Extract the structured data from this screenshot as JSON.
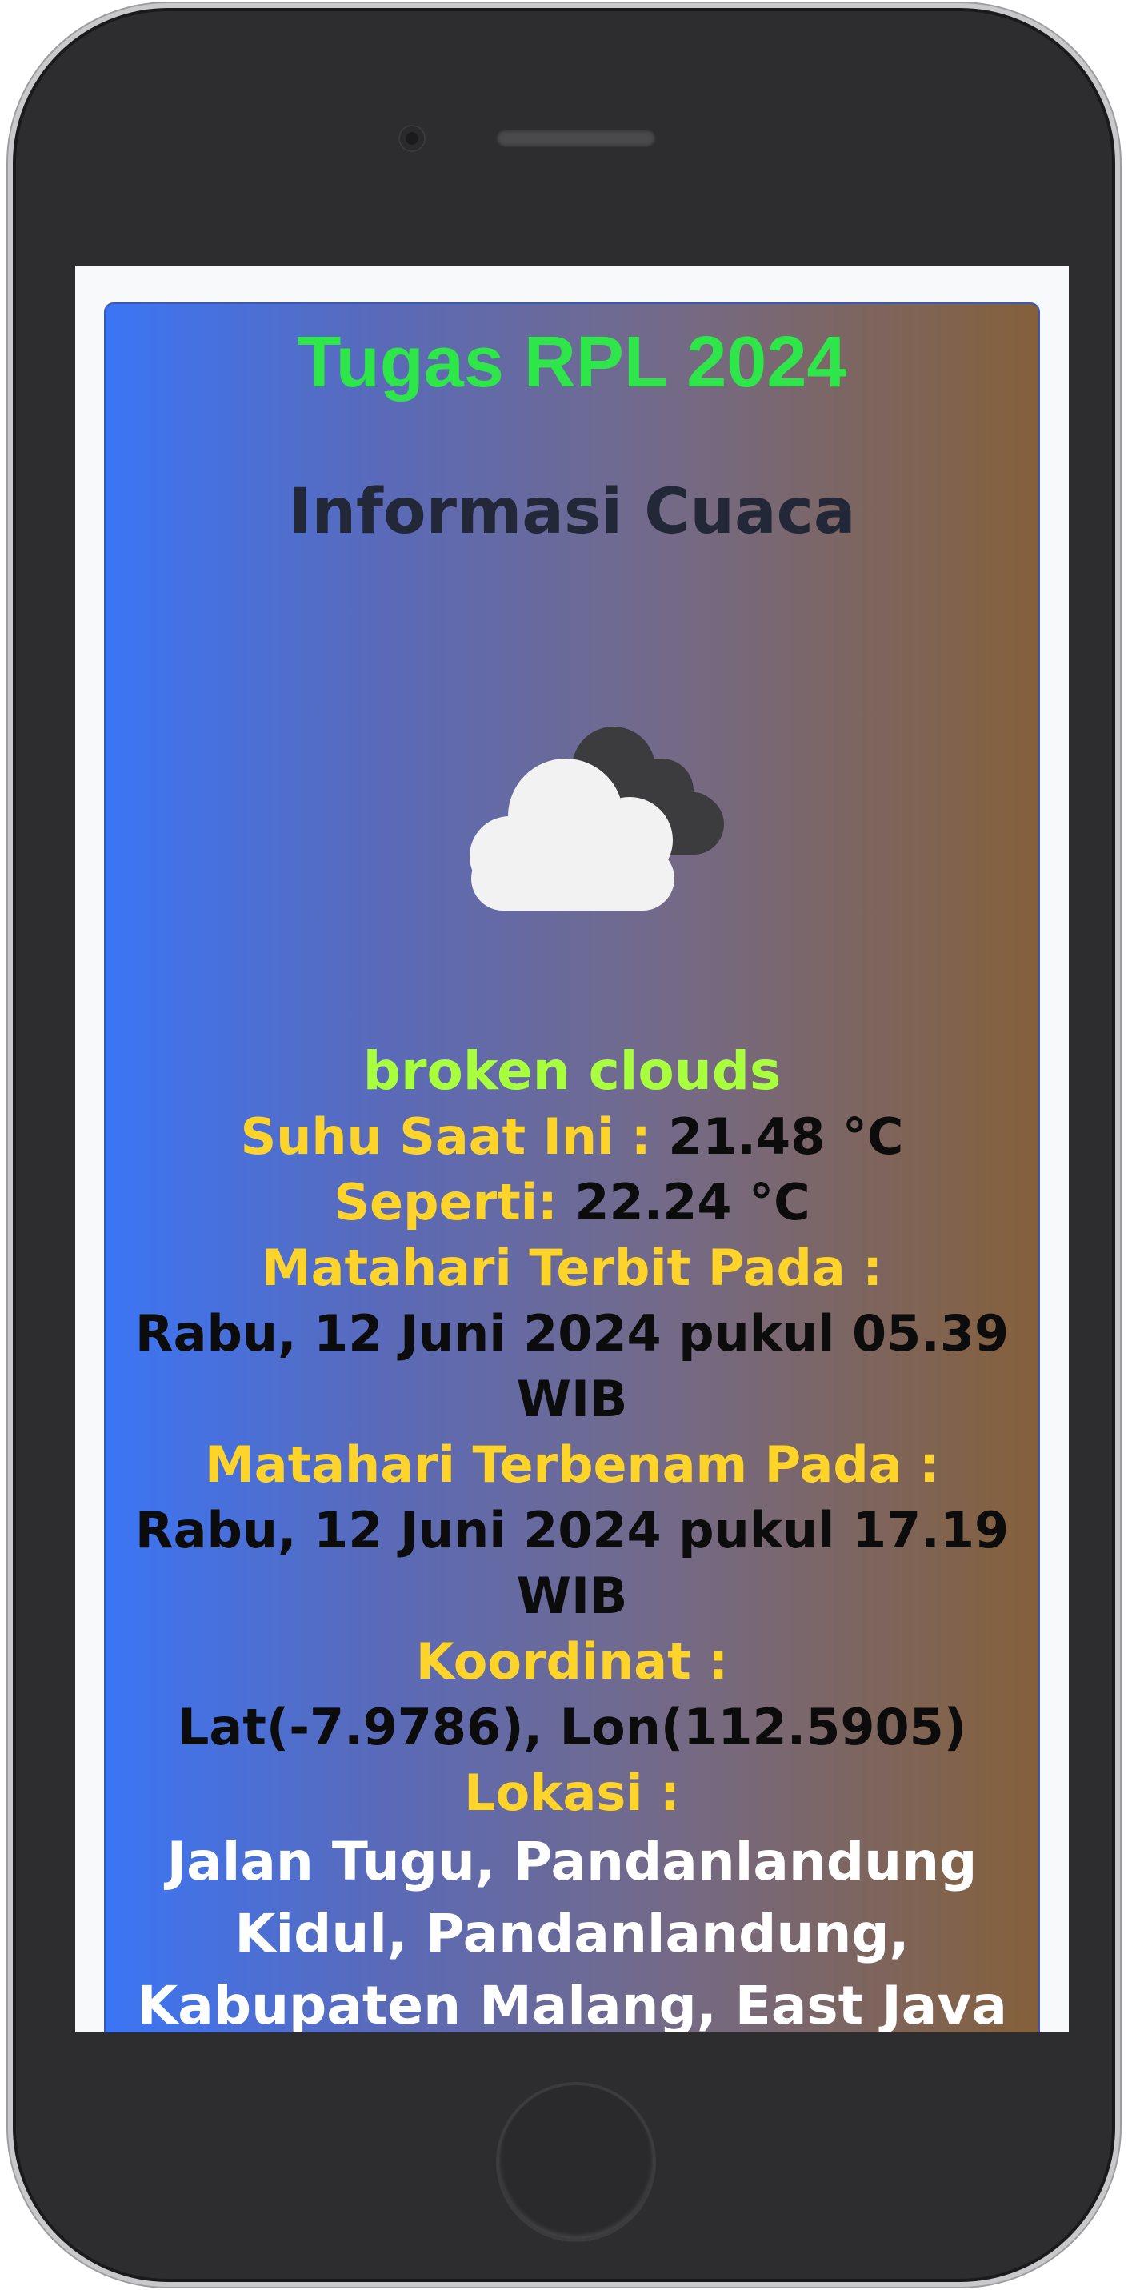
{
  "app": {
    "title": "Tugas RPL 2024",
    "subtitle": "Informasi Cuaca"
  },
  "weather": {
    "icon": "broken-clouds-icon",
    "description": "broken clouds",
    "temp_label": "Suhu Saat Ini : ",
    "temp_value": "21.48 °C",
    "feels_label": "Seperti:",
    "feels_value": "22.24 °C",
    "sunrise_label": "Matahari Terbit Pada :",
    "sunrise_value": "Rabu, 12 Juni 2024 pukul 05.39 WIB",
    "sunset_label": "Matahari Terbenam Pada :",
    "sunset_value": "Rabu, 12 Juni 2024 pukul 17.19 WIB",
    "coord_label": "Koordinat :",
    "coord_value": "Lat(-7.9786), Lon(112.5905)",
    "location_label": "Lokasi :",
    "location_value": "Jalan Tugu, Pandanlandung Kidul, Pandanlandung, Kabupaten Malang, East Java"
  },
  "colors": {
    "title": "#2ee54a",
    "label": "#ffd42a",
    "description": "#a8ff3e",
    "gradient_start": "#3b75f5",
    "gradient_end": "#85603a"
  }
}
